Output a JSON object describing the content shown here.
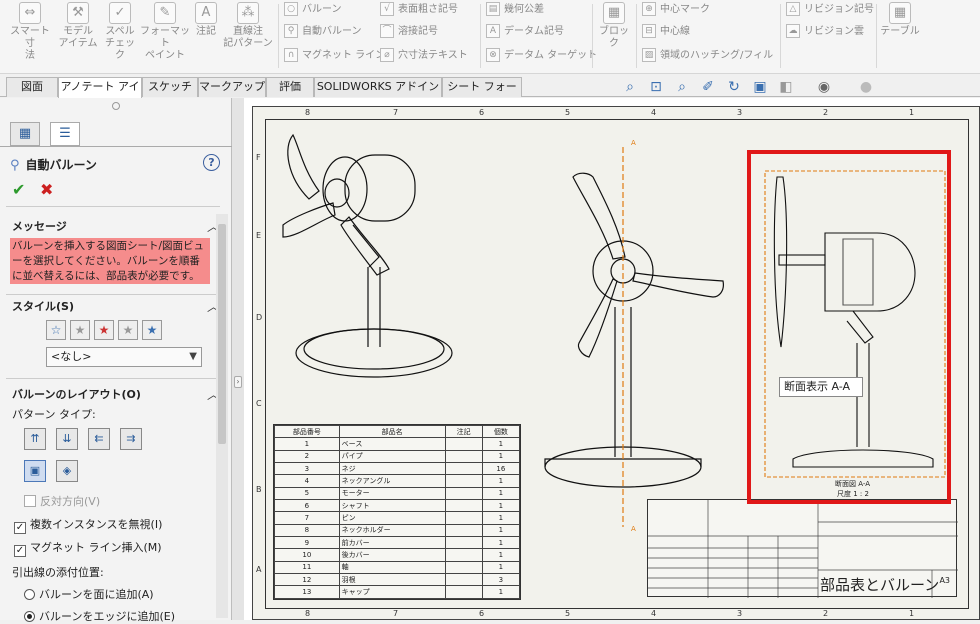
{
  "ribbon": {
    "big_tools": [
      {
        "label1": "スマート寸",
        "label2": "法"
      },
      {
        "label1": "モデル",
        "label2": "アイテム"
      },
      {
        "label1": "スペル",
        "label2": "チェック"
      },
      {
        "label1": "フォーマット",
        "label2": "ペイント"
      },
      {
        "label1": "注記",
        "label2": ""
      },
      {
        "label1": "直線注",
        "label2": "記パターン"
      }
    ],
    "small_tools": [
      "バルーン",
      "自動バルーン",
      "マグネット ライン",
      "表面粗さ記号",
      "溶接記号",
      "穴寸法テキスト",
      "幾何公差",
      "データム記号",
      "データム ターゲット",
      "中心マーク",
      "中心線",
      "領域のハッチング/フィル",
      "リビジョン記号",
      "リビジョン雲"
    ],
    "block_label": "ブロック",
    "table_label": "テーブル"
  },
  "tabs": [
    "図面",
    "アノテート アイテム",
    "スケッチ",
    "マークアップ",
    "評価",
    "SOLIDWORKS アドイン",
    "シート フォーマット"
  ],
  "panel": {
    "title": "自動バルーン",
    "help": "?",
    "ok": "✔",
    "cancel": "✖",
    "message_header": "メッセージ",
    "message": "バルーンを挿入する図面シート/図面ビューを選択してください。バルーンを順番に並べ替えるには、部品表が必要です。",
    "style_header": "スタイル(S)",
    "style_value": "<なし>",
    "layout_header": "バルーンのレイアウト(O)",
    "pattern_label": "パターン タイプ:",
    "reverse": "反対方向(V)",
    "ignore_multi": "複数インスタンスを無視(I)",
    "magnet": "マグネット ライン挿入(M)",
    "leader_label": "引出線の添付位置:",
    "face": "バルーンを面に追加(A)",
    "edge": "バルーンをエッジに追加(E)"
  },
  "drawing": {
    "zones_top": [
      "8",
      "7",
      "6",
      "5",
      "4",
      "3",
      "2",
      "1"
    ],
    "zones_side": [
      "F",
      "E",
      "D",
      "C",
      "B",
      "A"
    ],
    "section_marker": "A",
    "tooltip": "断面表示 A-A",
    "section_caption": "断面図 A-A",
    "scale_caption": "尺度 1 : 2",
    "title_text": "部品表とバルーン",
    "sheet_size": "A3",
    "bom_headers": [
      "部品番号",
      "部品名",
      "注記",
      "個数"
    ],
    "bom_rows": [
      [
        "1",
        "ベース",
        "",
        "1"
      ],
      [
        "2",
        "パイプ",
        "",
        "1"
      ],
      [
        "3",
        "ネジ",
        "",
        "16"
      ],
      [
        "4",
        "ネックアングル",
        "",
        "1"
      ],
      [
        "5",
        "モーター",
        "",
        "1"
      ],
      [
        "6",
        "シャフト",
        "",
        "1"
      ],
      [
        "7",
        "ピン",
        "",
        "1"
      ],
      [
        "8",
        "ネックホルダー",
        "",
        "1"
      ],
      [
        "9",
        "前カバー",
        "",
        "1"
      ],
      [
        "10",
        "後カバー",
        "",
        "1"
      ],
      [
        "11",
        "軸",
        "",
        "1"
      ],
      [
        "12",
        "羽根",
        "",
        "3"
      ],
      [
        "13",
        "キャップ",
        "",
        "1"
      ]
    ]
  }
}
